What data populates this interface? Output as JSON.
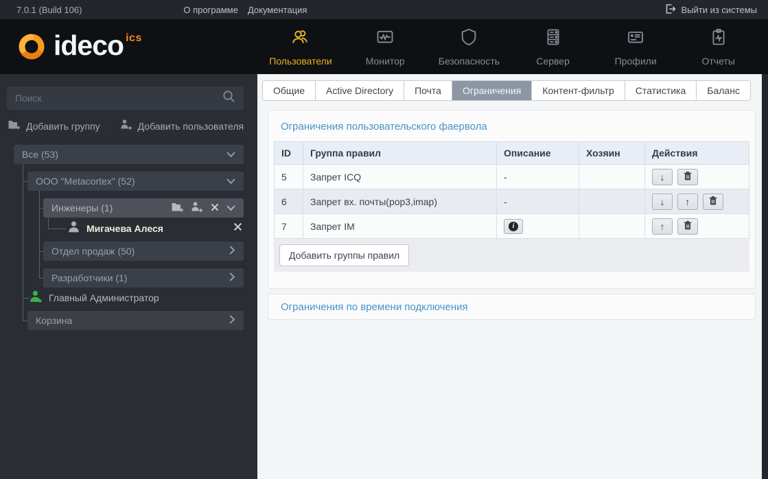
{
  "topbar": {
    "version": "7.0.1 (Build 106)",
    "about": "О программе",
    "docs": "Документация",
    "logout": "Выйти из системы"
  },
  "logo": {
    "brand": "ideco",
    "suffix": "ics"
  },
  "nav": {
    "items": [
      {
        "label": "Пользователи",
        "icon": "users-icon",
        "active": true
      },
      {
        "label": "Монитор",
        "icon": "monitor-icon",
        "active": false
      },
      {
        "label": "Безопасность",
        "icon": "shield-icon",
        "active": false
      },
      {
        "label": "Сервер",
        "icon": "server-icon",
        "active": false
      },
      {
        "label": "Профили",
        "icon": "id-card-icon",
        "active": false
      },
      {
        "label": "Отчеты",
        "icon": "report-icon",
        "active": false
      }
    ]
  },
  "sidebar": {
    "search_placeholder": "Поиск",
    "add_group": "Добавить группу",
    "add_user": "Добавить пользователя",
    "tree": {
      "all": "Все (53)",
      "company": "ООО \"Metacortex\" (52)",
      "engineers": "Инженеры (1)",
      "user": "Мигачева Алеся",
      "sales": "Отдел продаж (50)",
      "developers": "Разработчики (1)",
      "admin": "Главный Администратор",
      "trash": "Корзина"
    }
  },
  "main": {
    "tabs": [
      "Общие",
      "Active Directory",
      "Почта",
      "Ограничения",
      "Контент-фильтр",
      "Статистика",
      "Баланс"
    ],
    "active_tab": "Ограничения",
    "firewall": {
      "title": "Ограничения пользовательского фаервола",
      "headers": [
        "ID",
        "Группа правил",
        "Описание",
        "Хозяин",
        "Действия"
      ],
      "rows": [
        {
          "id": "5",
          "group": "Запрет ICQ",
          "description": "-",
          "owner": ""
        },
        {
          "id": "6",
          "group": "Запрет вх. почты(pop3,imap)",
          "description": "-",
          "owner": ""
        },
        {
          "id": "7",
          "group": "Запрет IM",
          "description": "",
          "owner": ""
        }
      ],
      "add_button": "Добавить группы правил"
    },
    "time_limits": {
      "title": "Ограничения по времени подключения"
    }
  },
  "icons": {
    "move_down": "↓",
    "move_up": "↑",
    "info": "i"
  },
  "colors": {
    "accent_gold": "#e8b11f",
    "link_blue": "#4694c8",
    "admin_green": "#3fae49",
    "active_tab_bg": "#8d96a5",
    "header_bg": "#0e1014",
    "sidebar_bg": "#2a2d34"
  }
}
